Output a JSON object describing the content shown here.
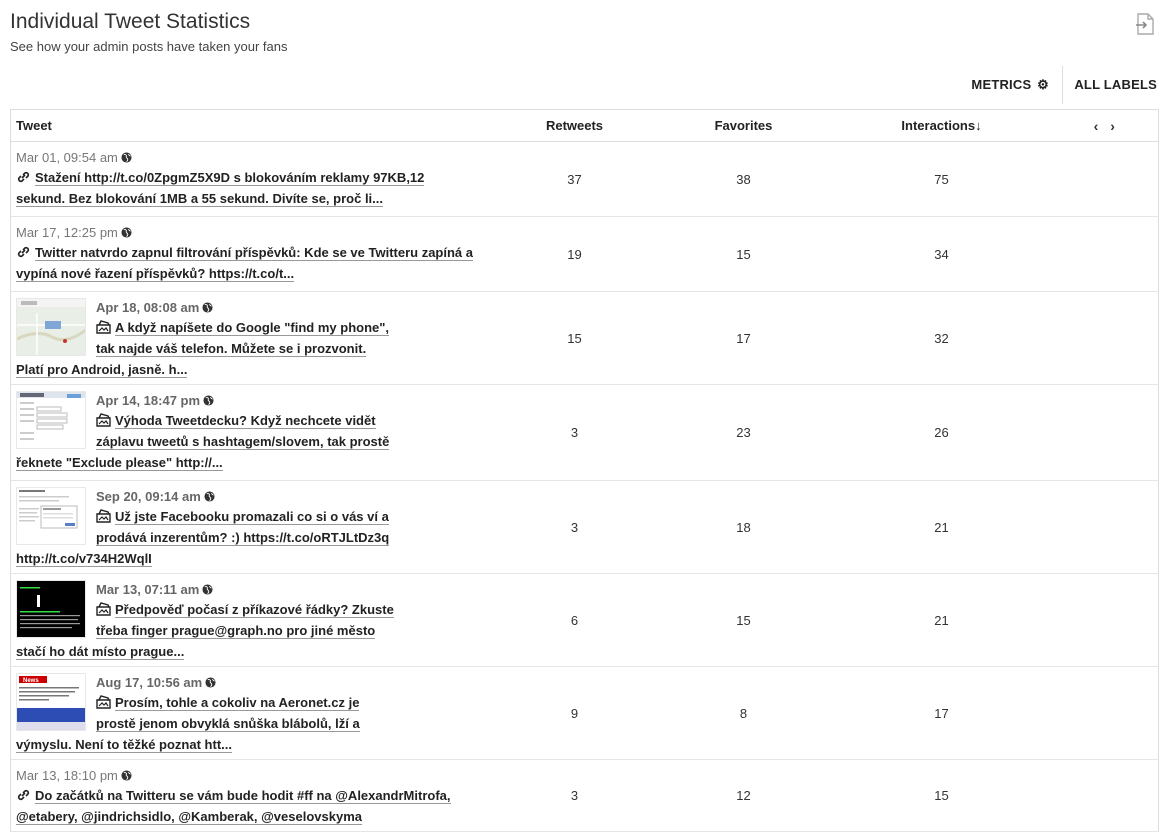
{
  "header": {
    "title": "Individual Tweet Statistics",
    "subtitle": "See how your admin posts have taken your fans"
  },
  "toolbar": {
    "metrics_label": "METRICS",
    "all_labels_label": "ALL LABELS"
  },
  "table": {
    "columns": {
      "tweet": "Tweet",
      "retweets": "Retweets",
      "favorites": "Favorites",
      "interactions": "Interactions↓",
      "pager": "‹ ›"
    },
    "rows": [
      {
        "date": "Mar 01, 09:54 am",
        "type": "link-icon",
        "thumb": null,
        "text": "Stažení http://t.co/0ZpgmZ5X9D s blokováním reklamy 97KB,12 sekund. Bez blokování 1MB a 55 sekund. Divíte se, proč li...",
        "retweets": "37",
        "favorites": "38",
        "interactions": "75"
      },
      {
        "date": "Mar 17, 12:25 pm",
        "type": "link-icon",
        "thumb": null,
        "text": "Twitter natvrdo zapnul filtrování příspěvků: Kde se ve Twitteru zapíná a vypíná nové řazení příspěvků? https://t.co/t...",
        "retweets": "19",
        "favorites": "15",
        "interactions": "34"
      },
      {
        "date": "Apr 18, 08:08 am",
        "type": "photo-icon",
        "thumb": "map",
        "text": "A když napíšete do Google \"find my phone\", tak najde váš telefon. Můžete se i prozvonit. Platí pro Android, jasně. h...",
        "retweets": "15",
        "favorites": "17",
        "interactions": "32"
      },
      {
        "date": "Apr 14, 18:47 pm",
        "type": "photo-icon",
        "thumb": "form",
        "text": "Výhoda Tweetdecku? Když nechcete vidět záplavu tweetů s hashtagem/slovem, tak prostě řeknete \"Exclude please\" http://...",
        "retweets": "3",
        "favorites": "23",
        "interactions": "26"
      },
      {
        "date": "Sep 20, 09:14 am",
        "type": "photo-icon",
        "thumb": "doc",
        "text": "Už jste Facebooku promazali co si o vás ví a prodává inzerentům? :) https://t.co/oRTJLtDz3q http://t.co/v734H2WqlI",
        "retweets": "3",
        "favorites": "18",
        "interactions": "21"
      },
      {
        "date": "Mar 13, 07:11 am",
        "type": "photo-icon",
        "thumb": "terminal",
        "text": "Předpověď počasí z příkazové řádky? Zkuste třeba finger prague@graph.no pro jiné město stačí ho dát místo prague...",
        "retweets": "6",
        "favorites": "15",
        "interactions": "21"
      },
      {
        "date": "Aug 17, 10:56 am",
        "type": "photo-icon",
        "thumb": "news",
        "text": "Prosím, tohle a cokoliv na Aeronet.cz je prostě jenom obvyklá snůška blábolů, lží a výmyslu. Není to těžké poznat htt...",
        "retweets": "9",
        "favorites": "8",
        "interactions": "17"
      },
      {
        "date": "Mar 13, 18:10 pm",
        "type": "link-icon",
        "thumb": null,
        "text": "Do začátků na Twitteru se vám bude hodit #ff na @AlexandrMitrofa, @etabery, @jindrichsidlo, @Kamberak, @veselovskyma",
        "retweets": "3",
        "favorites": "12",
        "interactions": "15"
      }
    ]
  }
}
